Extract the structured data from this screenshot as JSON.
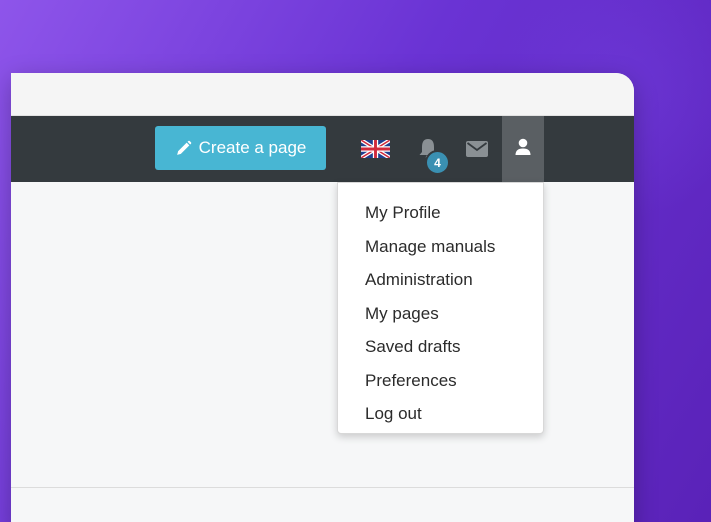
{
  "navbar": {
    "create_button": {
      "label": "Create a page",
      "icon": "pencil-icon",
      "color": "#48b6d3"
    },
    "language": {
      "icon": "uk-flag-icon"
    },
    "notifications": {
      "icon": "bell-icon",
      "count": "4"
    },
    "messages": {
      "icon": "envelope-icon"
    },
    "user": {
      "icon": "user-icon"
    },
    "background_color": "#343a3e"
  },
  "user_menu": {
    "items": [
      {
        "label": "My Profile"
      },
      {
        "label": "Manage manuals"
      },
      {
        "label": "Administration"
      },
      {
        "label": "My pages"
      },
      {
        "label": "Saved drafts"
      },
      {
        "label": "Preferences"
      },
      {
        "label": "Log out"
      }
    ]
  },
  "colors": {
    "background_gradient_start": "#8e55ea",
    "background_gradient_end": "#5a22b8",
    "badge": "#3a90b2"
  }
}
